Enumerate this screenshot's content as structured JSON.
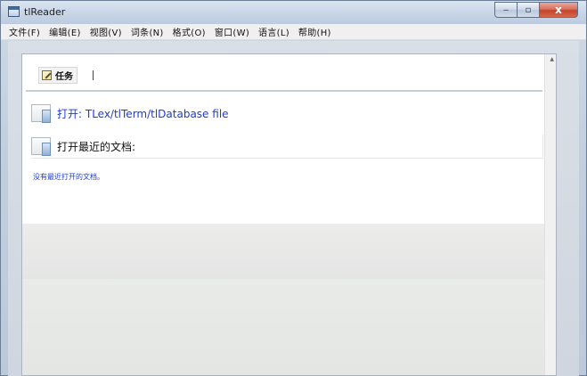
{
  "window": {
    "title": "tlReader"
  },
  "window_controls": {
    "minimize": "‒",
    "maximize": "▫",
    "close": "x"
  },
  "menu": [
    {
      "label": "文件(F)"
    },
    {
      "label": "编辑(E)"
    },
    {
      "label": "视图(V)"
    },
    {
      "label": "词条(N)"
    },
    {
      "label": "格式(O)"
    },
    {
      "label": "窗口(W)"
    },
    {
      "label": "语言(L)"
    },
    {
      "label": "帮助(H)"
    }
  ],
  "tab": {
    "task_label": "任务",
    "separator": "|"
  },
  "start_page": {
    "open_link": "打开: TLex/tlTerm/tlDatabase file",
    "recent_heading": "打开最近的文档:",
    "no_recent": "没有最近打开的文档。"
  },
  "colors": {
    "link": "#1f3bd0",
    "close_button": "#c4432a"
  },
  "icons": {
    "app": "app-window-icon",
    "task": "edit-icon",
    "document": "document-icon"
  }
}
